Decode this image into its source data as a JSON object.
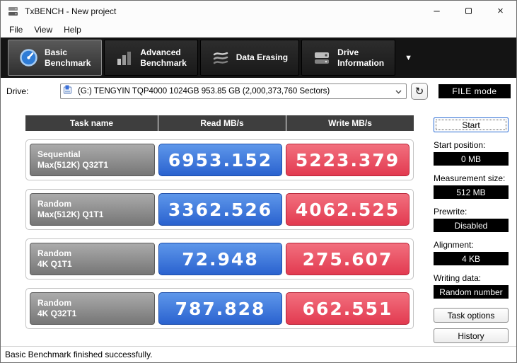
{
  "window": {
    "title": "TxBENCH - New project",
    "status": "Basic Benchmark finished successfully."
  },
  "menu": [
    "File",
    "View",
    "Help"
  ],
  "tabs": [
    {
      "line1": "Basic",
      "line2": "Benchmark",
      "selected": true
    },
    {
      "line1": "Advanced",
      "line2": "Benchmark",
      "selected": false
    },
    {
      "line1": "Data Erasing",
      "line2": "",
      "selected": false
    },
    {
      "line1": "Drive",
      "line2": "Information",
      "selected": false
    }
  ],
  "drive": {
    "label": "Drive:",
    "value": "(G:) TENGYIN TQP4000 1024GB  953.85 GB (2,000,373,760 Sectors)",
    "file_mode": "FILE mode"
  },
  "table": {
    "headers": [
      "Task name",
      "Read MB/s",
      "Write MB/s"
    ],
    "rows": [
      {
        "task_line1": "Sequential",
        "task_line2": "Max(512K) Q32T1",
        "read": "6953.152",
        "write": "5223.379"
      },
      {
        "task_line1": "Random",
        "task_line2": "Max(512K) Q1T1",
        "read": "3362.526",
        "write": "4062.525"
      },
      {
        "task_line1": "Random",
        "task_line2": "4K Q1T1",
        "read": "72.948",
        "write": "275.607"
      },
      {
        "task_line1": "Random",
        "task_line2": "4K Q32T1",
        "read": "787.828",
        "write": "662.551"
      }
    ]
  },
  "sidebar": {
    "start_label": "Start",
    "fields": [
      {
        "label": "Start position:",
        "value": "0 MB"
      },
      {
        "label": "Measurement size:",
        "value": "512 MB"
      },
      {
        "label": "Prewrite:",
        "value": "Disabled"
      },
      {
        "label": "Alignment:",
        "value": "4 KB"
      },
      {
        "label": "Writing data:",
        "value": "Random number"
      }
    ],
    "task_options_label": "Task options",
    "history_label": "History"
  },
  "icons": {
    "minimize": "–",
    "close": "×",
    "refresh": "↻",
    "caret_down": "▼"
  },
  "colors": {
    "read_cell": "#2a62cf",
    "write_cell": "#e23a50",
    "value_field_bg": "#000000",
    "toolbar_bg": "#141414"
  }
}
